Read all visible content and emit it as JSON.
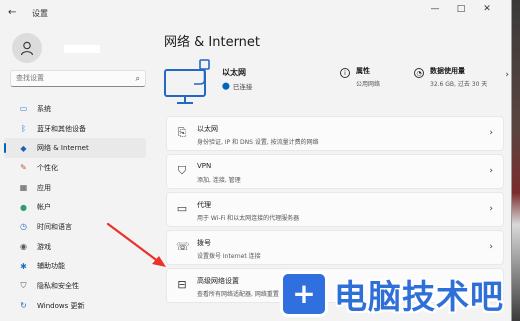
{
  "window": {
    "title": "设置",
    "back_glyph": "←",
    "controls": {
      "minimize": "—",
      "maximize": "□",
      "close": "✕"
    }
  },
  "sidebar": {
    "search_placeholder": "查找设置",
    "items": [
      {
        "label": "系统",
        "icon": "monitor-icon",
        "glyph": "▭"
      },
      {
        "label": "蓝牙和其他设备",
        "icon": "bluetooth-icon",
        "glyph": "ᛒ"
      },
      {
        "label": "网络 & Internet",
        "icon": "wifi-icon",
        "glyph": "◆",
        "active": true
      },
      {
        "label": "个性化",
        "icon": "brush-icon",
        "glyph": "✎"
      },
      {
        "label": "应用",
        "icon": "apps-icon",
        "glyph": "▦"
      },
      {
        "label": "帐户",
        "icon": "account-icon",
        "glyph": "●"
      },
      {
        "label": "时间和语言",
        "icon": "globe-clock-icon",
        "glyph": "◷"
      },
      {
        "label": "游戏",
        "icon": "gamepad-icon",
        "glyph": "◉"
      },
      {
        "label": "辅助功能",
        "icon": "accessibility-icon",
        "glyph": "✱"
      },
      {
        "label": "隐私和安全性",
        "icon": "shield-icon",
        "glyph": "⛉"
      },
      {
        "label": "Windows 更新",
        "icon": "update-icon",
        "glyph": "↻"
      }
    ],
    "accent_color": "#0067c0"
  },
  "main": {
    "page_title": "网络 & Internet",
    "hero": {
      "title": "以太网",
      "status": "已连接",
      "properties": {
        "title": "属性",
        "sub": "公用网络"
      },
      "usage": {
        "title": "数据使用量",
        "sub": "32.6 GB, 过去 30 天"
      },
      "chevron": "›"
    },
    "cards": [
      {
        "title": "以太网",
        "sub": "身份验证, IP 和 DNS 设置, 按流量计费的网络",
        "icon": "ethernet-icon",
        "glyph": "⎘"
      },
      {
        "title": "VPN",
        "sub": "添加, 连接, 管理",
        "icon": "vpn-shield-icon",
        "glyph": "⛉"
      },
      {
        "title": "代理",
        "sub": "用于 Wi-Fi 和以太网连接的代理服务器",
        "icon": "proxy-icon",
        "glyph": "▭"
      },
      {
        "title": "拨号",
        "sub": "设置拨号 Internet 连接",
        "icon": "dialup-icon",
        "glyph": "☏"
      },
      {
        "title": "高级网络设置",
        "sub": "查看所有网络适配器, 网络重置",
        "icon": "network-adapter-icon",
        "glyph": "⊟"
      }
    ],
    "chevron": "›"
  },
  "watermark": {
    "logo_glyph": "+",
    "text": "电脑技术吧"
  },
  "annotation": {
    "arrow_color": "#e8322a"
  }
}
